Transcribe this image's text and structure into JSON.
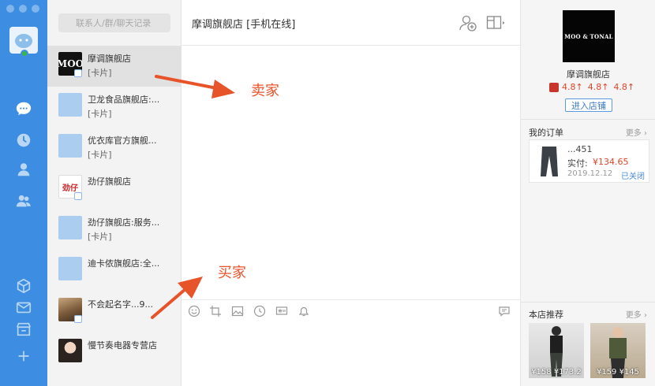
{
  "search": {
    "placeholder": "联系人/群/聊天记录"
  },
  "contacts": [
    {
      "name": "摩调旗舰店",
      "sub": "[卡片]"
    },
    {
      "name": "卫龙食品旗舰店:...",
      "sub": "[卡片]"
    },
    {
      "name": "优衣库官方旗舰...",
      "sub": "[卡片]"
    },
    {
      "name": "劲仔旗舰店",
      "sub": ""
    },
    {
      "name": "劲仔旗舰店:服务...",
      "sub": "[卡片]"
    },
    {
      "name": "迪卡侬旗舰店:全...",
      "sub": ""
    },
    {
      "name": "不会起名字...9...",
      "sub": ""
    },
    {
      "name": "慢节奏电器专营店",
      "sub": ""
    }
  ],
  "contact_avatars": {
    "moo": "MOO",
    "jinzai": "劲仔"
  },
  "chat": {
    "title": "摩调旗舰店 [手机在线]"
  },
  "annotations": {
    "seller": "卖家",
    "buyer": "买家"
  },
  "shop": {
    "logo_text": "MOO & TONAL",
    "name": "摩调旗舰店",
    "ratings": [
      "4.8↑",
      "4.8↑",
      "4.8↑"
    ],
    "enter_label": "进入店铺",
    "order_section": "我的订单",
    "more": "更多",
    "order": {
      "id": "...451",
      "paid_label": "实付:",
      "paid": "¥134.65",
      "date": "2019.12.12",
      "status": "已关闭"
    },
    "recommend_section": "本店推荐",
    "recommend_prices": [
      "¥158 ¥173.2",
      "¥159 ¥145"
    ]
  },
  "colors": {
    "rail": "#3d8ee2",
    "accent_orange": "#e8542a",
    "price_red": "#e0452a"
  }
}
